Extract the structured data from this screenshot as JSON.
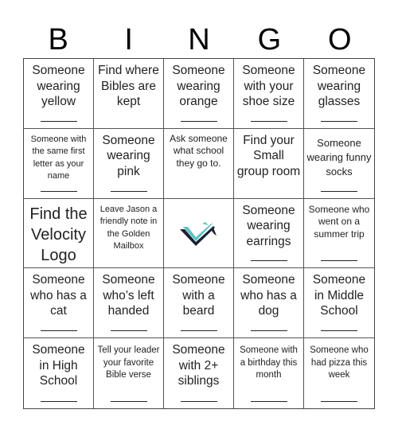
{
  "header": {
    "letters": [
      "B",
      "I",
      "N",
      "G",
      "O"
    ]
  },
  "colors": {
    "logo_teal": "#5bc4c8",
    "logo_navy": "#1c2033",
    "grid_border": "#444444"
  },
  "cells": [
    {
      "text": "Someone wearing yellow",
      "blank": true
    },
    {
      "text": "Find where Bibles are kept",
      "blank": false
    },
    {
      "text": "Someone wearing orange",
      "blank": true
    },
    {
      "text": "Someone with your shoe size",
      "blank": true
    },
    {
      "text": "Someone wearing glasses",
      "blank": true
    },
    {
      "text": "Someone with the same first letter as your name",
      "blank": true
    },
    {
      "text": "Someone wearing pink",
      "blank": true
    },
    {
      "text": "Ask someone what school they go to.",
      "blank": false
    },
    {
      "text": "Find your Small group room",
      "blank": false
    },
    {
      "text": "Someone wearing funny socks",
      "blank": true
    },
    {
      "text": "Find the Velocity Logo",
      "blank": false
    },
    {
      "text": "Leave Jason a friendly note in the Golden Mailbox",
      "blank": false
    },
    {
      "text": "",
      "free": true,
      "icon": "velocity-logo-icon"
    },
    {
      "text": "Someone wearing earrings",
      "blank": true
    },
    {
      "text": "Someone who went on a summer trip",
      "blank": true
    },
    {
      "text": "Someone who has a cat",
      "blank": true
    },
    {
      "text": "Someone who’s left handed",
      "blank": true
    },
    {
      "text": "Someone with a beard",
      "blank": true
    },
    {
      "text": "Someone who has a dog",
      "blank": true
    },
    {
      "text": "Someone in Middle School",
      "blank": true
    },
    {
      "text": "Someone in High School",
      "blank": true
    },
    {
      "text": "Tell your leader your favorite Bible verse",
      "blank": true
    },
    {
      "text": "Someone with 2+ siblings",
      "blank": true
    },
    {
      "text": "Someone with a birthday this month",
      "blank": true
    },
    {
      "text": "Someone who had pizza this week",
      "blank": true
    }
  ]
}
